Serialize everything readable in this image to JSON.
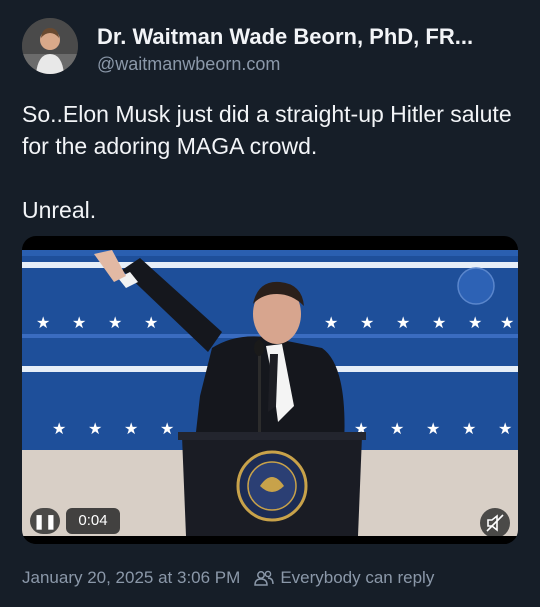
{
  "post": {
    "author_name": "Dr. Waitman Wade Beorn, PhD, FR...",
    "author_handle": "@waitmanwbeorn.com",
    "text_line1": "So..Elon Musk just did a straight-up Hitler salute for the adoring MAGA crowd.",
    "text_line2": "Unreal.",
    "timestamp": "January 20, 2025 at 3:06 PM",
    "reply_setting": "Everybody can reply"
  },
  "video": {
    "elapsed": "0:04",
    "icons": [
      "pause-icon",
      "mute-icon",
      "people-icon"
    ]
  },
  "colors": {
    "background": "#161e28",
    "text": "#f2f4f7",
    "muted": "#8b98a9",
    "stage_blue": "#1e4f9a"
  }
}
